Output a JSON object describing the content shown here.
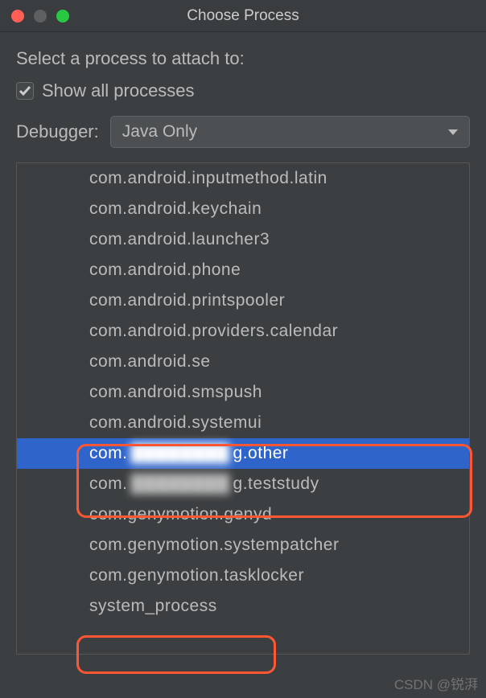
{
  "titlebar": {
    "title": "Choose Process"
  },
  "prompt": "Select a process to attach to:",
  "checkbox": {
    "label": "Show all processes",
    "checked": true
  },
  "debugger": {
    "label": "Debugger:",
    "selected": "Java Only"
  },
  "processes": [
    {
      "name": "com.android.inputmethod.latin",
      "selected": false
    },
    {
      "name": "com.android.keychain",
      "selected": false
    },
    {
      "name": "com.android.launcher3",
      "selected": false
    },
    {
      "name": "com.android.phone",
      "selected": false
    },
    {
      "name": "com.android.printspooler",
      "selected": false
    },
    {
      "name": "com.android.providers.calendar",
      "selected": false
    },
    {
      "name": "com.android.se",
      "selected": false
    },
    {
      "name": "com.android.smspush",
      "selected": false
    },
    {
      "name": "com.android.systemui",
      "selected": false
    },
    {
      "name_prefix": "com.",
      "name_suffix": "g.other",
      "redacted": true,
      "selected": true
    },
    {
      "name_prefix": "com.",
      "name_suffix": "g.teststudy",
      "redacted": true,
      "selected": false
    },
    {
      "name": "com.genymotion.genyd",
      "selected": false
    },
    {
      "name": "com.genymotion.systempatcher",
      "selected": false
    },
    {
      "name": "com.genymotion.tasklocker",
      "selected": false
    },
    {
      "name": "system_process",
      "selected": false
    }
  ],
  "watermark": "CSDN @锐湃"
}
